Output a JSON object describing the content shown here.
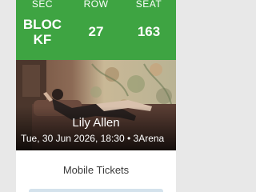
{
  "seat": {
    "sec_label": "SEC",
    "row_label": "ROW",
    "seat_label": "SEAT",
    "sec_value_line1": "BLOC",
    "sec_value_line2": "KF",
    "row_value": "27",
    "seat_value": "163"
  },
  "event": {
    "artist": "Lily Allen",
    "date_venue": "Tue, 30 Jun 2026, 18:30 • 3Arena"
  },
  "footer": {
    "mobile_tickets_label": "Mobile Tickets"
  },
  "colors": {
    "accent": "#3ea442"
  }
}
